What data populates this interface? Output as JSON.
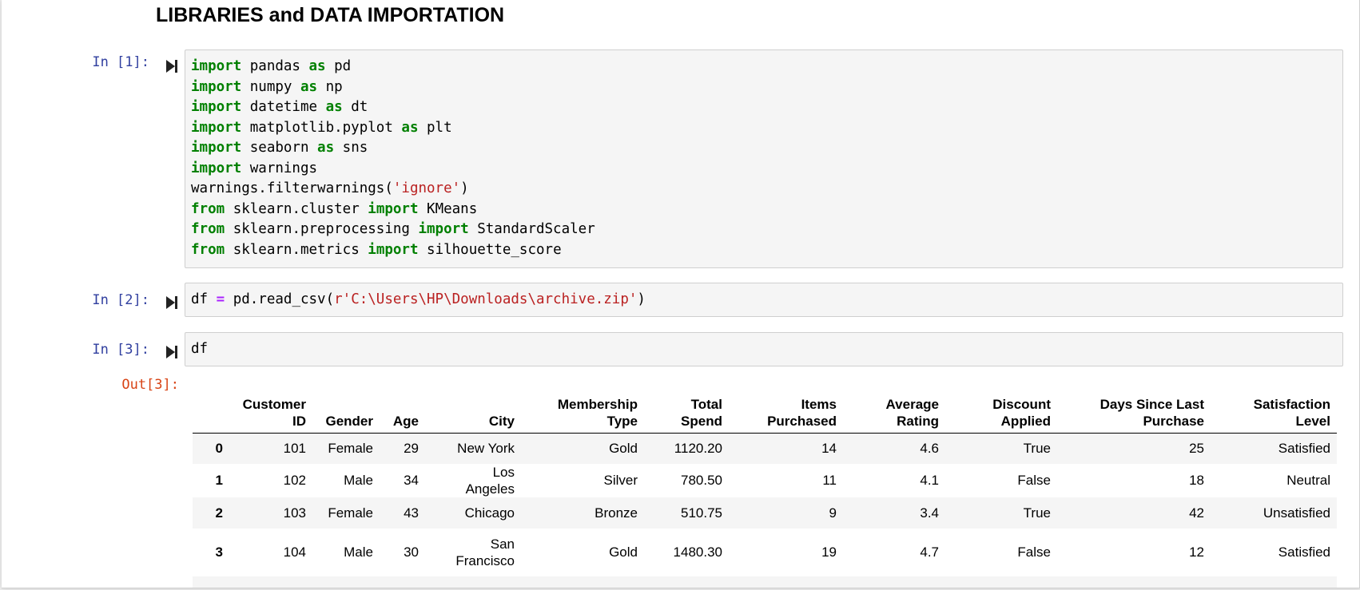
{
  "section_heading": "LIBRARIES and DATA IMPORTATION",
  "cells": [
    {
      "prompt": "In [1]:",
      "lines": [
        [
          [
            "kw",
            "import"
          ],
          [
            "t",
            " pandas "
          ],
          [
            "kw",
            "as"
          ],
          [
            "t",
            " pd"
          ]
        ],
        [
          [
            "kw",
            "import"
          ],
          [
            "t",
            " numpy "
          ],
          [
            "kw",
            "as"
          ],
          [
            "t",
            " np"
          ]
        ],
        [
          [
            "kw",
            "import"
          ],
          [
            "t",
            " datetime "
          ],
          [
            "kw",
            "as"
          ],
          [
            "t",
            " dt"
          ]
        ],
        [
          [
            "kw",
            "import"
          ],
          [
            "t",
            " matplotlib.pyplot "
          ],
          [
            "kw",
            "as"
          ],
          [
            "t",
            " plt"
          ]
        ],
        [
          [
            "kw",
            "import"
          ],
          [
            "t",
            " seaborn "
          ],
          [
            "kw",
            "as"
          ],
          [
            "t",
            " sns"
          ]
        ],
        [
          [
            "kw",
            "import"
          ],
          [
            "t",
            " warnings"
          ]
        ],
        [
          [
            "t",
            "warnings.filterwarnings("
          ],
          [
            "str",
            "'ignore'"
          ],
          [
            "t",
            ")"
          ]
        ],
        [
          [
            "kw",
            "from"
          ],
          [
            "t",
            " sklearn.cluster "
          ],
          [
            "kw",
            "import"
          ],
          [
            "t",
            " KMeans"
          ]
        ],
        [
          [
            "kw",
            "from"
          ],
          [
            "t",
            " sklearn.preprocessing "
          ],
          [
            "kw",
            "import"
          ],
          [
            "t",
            " StandardScaler"
          ]
        ],
        [
          [
            "kw",
            "from"
          ],
          [
            "t",
            " sklearn.metrics "
          ],
          [
            "kw",
            "import"
          ],
          [
            "t",
            " silhouette_score"
          ]
        ]
      ]
    },
    {
      "prompt": "In [2]:",
      "lines": [
        [
          [
            "t",
            "df "
          ],
          [
            "op",
            "="
          ],
          [
            "t",
            " pd.read_csv("
          ],
          [
            "str",
            "r'C:\\Users\\HP\\Downloads\\archive.zip'"
          ],
          [
            "t",
            ")"
          ]
        ]
      ]
    },
    {
      "prompt": "In [3]:",
      "lines": [
        [
          [
            "t",
            "df"
          ]
        ]
      ]
    }
  ],
  "output_prompt": "Out[3]:",
  "table": {
    "columns": [
      "",
      "Customer ID",
      "Gender",
      "Age",
      "City",
      "Membership Type",
      "Total Spend",
      "Items Purchased",
      "Average Rating",
      "Discount Applied",
      "Days Since Last Purchase",
      "Satisfaction Level"
    ],
    "rows": [
      [
        "0",
        "101",
        "Female",
        "29",
        "New York",
        "Gold",
        "1120.20",
        "14",
        "4.6",
        "True",
        "25",
        "Satisfied"
      ],
      [
        "1",
        "102",
        "Male",
        "34",
        "Los Angeles",
        "Silver",
        "780.50",
        "11",
        "4.1",
        "False",
        "18",
        "Neutral"
      ],
      [
        "2",
        "103",
        "Female",
        "43",
        "Chicago",
        "Bronze",
        "510.75",
        "9",
        "3.4",
        "True",
        "42",
        "Unsatisfied"
      ],
      [
        "3",
        "104",
        "Male",
        "30",
        "San Francisco",
        "Gold",
        "1480.30",
        "19",
        "4.7",
        "False",
        "12",
        "Satisfied"
      ]
    ]
  },
  "icons": {
    "run": "run-cell-icon"
  },
  "colors": {
    "keyword": "#008000",
    "string": "#ba2121",
    "operator": "#aa22ff",
    "in_prompt": "#303f9f",
    "out_prompt": "#d84315"
  }
}
